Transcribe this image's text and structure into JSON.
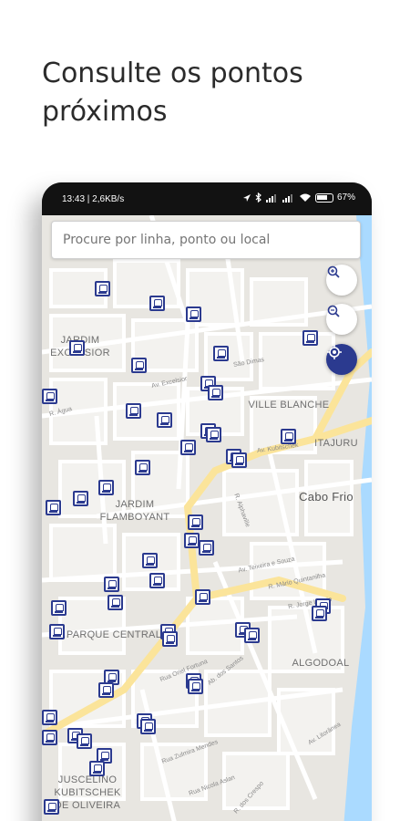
{
  "headline": {
    "line1": "Consulte os pontos",
    "line2": "próximos"
  },
  "status_bar": {
    "time": "13:43 | 2,6KB/s",
    "battery": "67%"
  },
  "search": {
    "placeholder": "Procure por linha, ponto ou local"
  },
  "map_controls": {
    "zoom_in_icon": "zoom-in-icon",
    "zoom_out_icon": "zoom-out-icon",
    "locate_icon": "my-location-icon",
    "accent_color": "#2b3a8f"
  },
  "map_labels": {
    "jardim_excelsior": "JARDIM EXCELSIOR",
    "ville_blanche": "VILLE BLANCHE",
    "itajuru": "ITAJURU",
    "cabo_frio": "Cabo Frio",
    "jardim_flamboyant": "JARDIM FLAMBOYANT",
    "parque_central": "PARQUE CENTRAL",
    "algodoal": "ALGODOAL",
    "juscelino": "JUSCELINO KUBITSCHEK DE OLIVEIRA"
  },
  "streets": {
    "excelsior": "Av. Excelsior",
    "sao_dimas": "São Dimas",
    "kubitschek": "Av. Kubitschek",
    "teixeira": "Av. Teixeira e Souza",
    "quintanilha": "R. Mário Quintanilha",
    "lossio": "R. Jorge Lossio",
    "fortuna": "Rua Oriel Fortuna",
    "santos": "Ab. dos Santos",
    "zulmira": "Rua Zulmira Mendes",
    "nicola": "Rua Nicola Aslan",
    "crespo": "R. dos Crespo",
    "litoranea": "Av. Litorânea",
    "alphaville": "R. Alphaville",
    "agua": "R. Água"
  },
  "bus_stop_icon": "bus-stop-icon"
}
